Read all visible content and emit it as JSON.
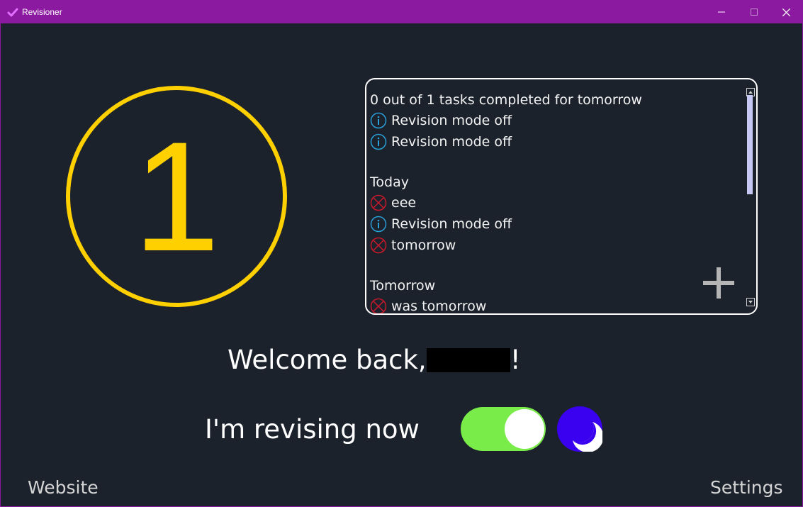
{
  "window": {
    "title": "Revisioner",
    "colors": {
      "titlebar": "#8b1aa0",
      "background": "#1b222c"
    }
  },
  "counter": {
    "value": "1",
    "color": "#ffd000"
  },
  "tasks": {
    "lines": [
      {
        "text": "0 out of 1 tasks completed for tomorrow",
        "icon": null,
        "kind": "heading"
      },
      {
        "text": "Revision mode off",
        "icon": "info-icon",
        "kind": "item"
      },
      {
        "text": "Revision mode off",
        "icon": "info-icon",
        "kind": "item"
      },
      {
        "text": "",
        "icon": null,
        "kind": "blank"
      },
      {
        "text": "Today",
        "icon": null,
        "kind": "heading"
      },
      {
        "text": "eee",
        "icon": "incomplete-icon",
        "kind": "item"
      },
      {
        "text": "Revision mode off",
        "icon": "info-icon",
        "kind": "item"
      },
      {
        "text": "tomorrow",
        "icon": "incomplete-icon",
        "kind": "item"
      },
      {
        "text": "",
        "icon": null,
        "kind": "blank"
      },
      {
        "text": "Tomorrow",
        "icon": null,
        "kind": "heading"
      },
      {
        "text": "was tomorrow",
        "icon": "incomplete-icon",
        "kind": "item"
      }
    ],
    "add_icon": "plus-icon"
  },
  "welcome": {
    "prefix": "Welcome back,",
    "suffix": "!"
  },
  "revising": {
    "label": "I'm revising now",
    "toggle_on": true,
    "toggle_color": "#7aec4a",
    "theme_icon": "moon-icon",
    "theme_color": "#3a00f0"
  },
  "footer": {
    "website": "Website",
    "settings": "Settings"
  }
}
